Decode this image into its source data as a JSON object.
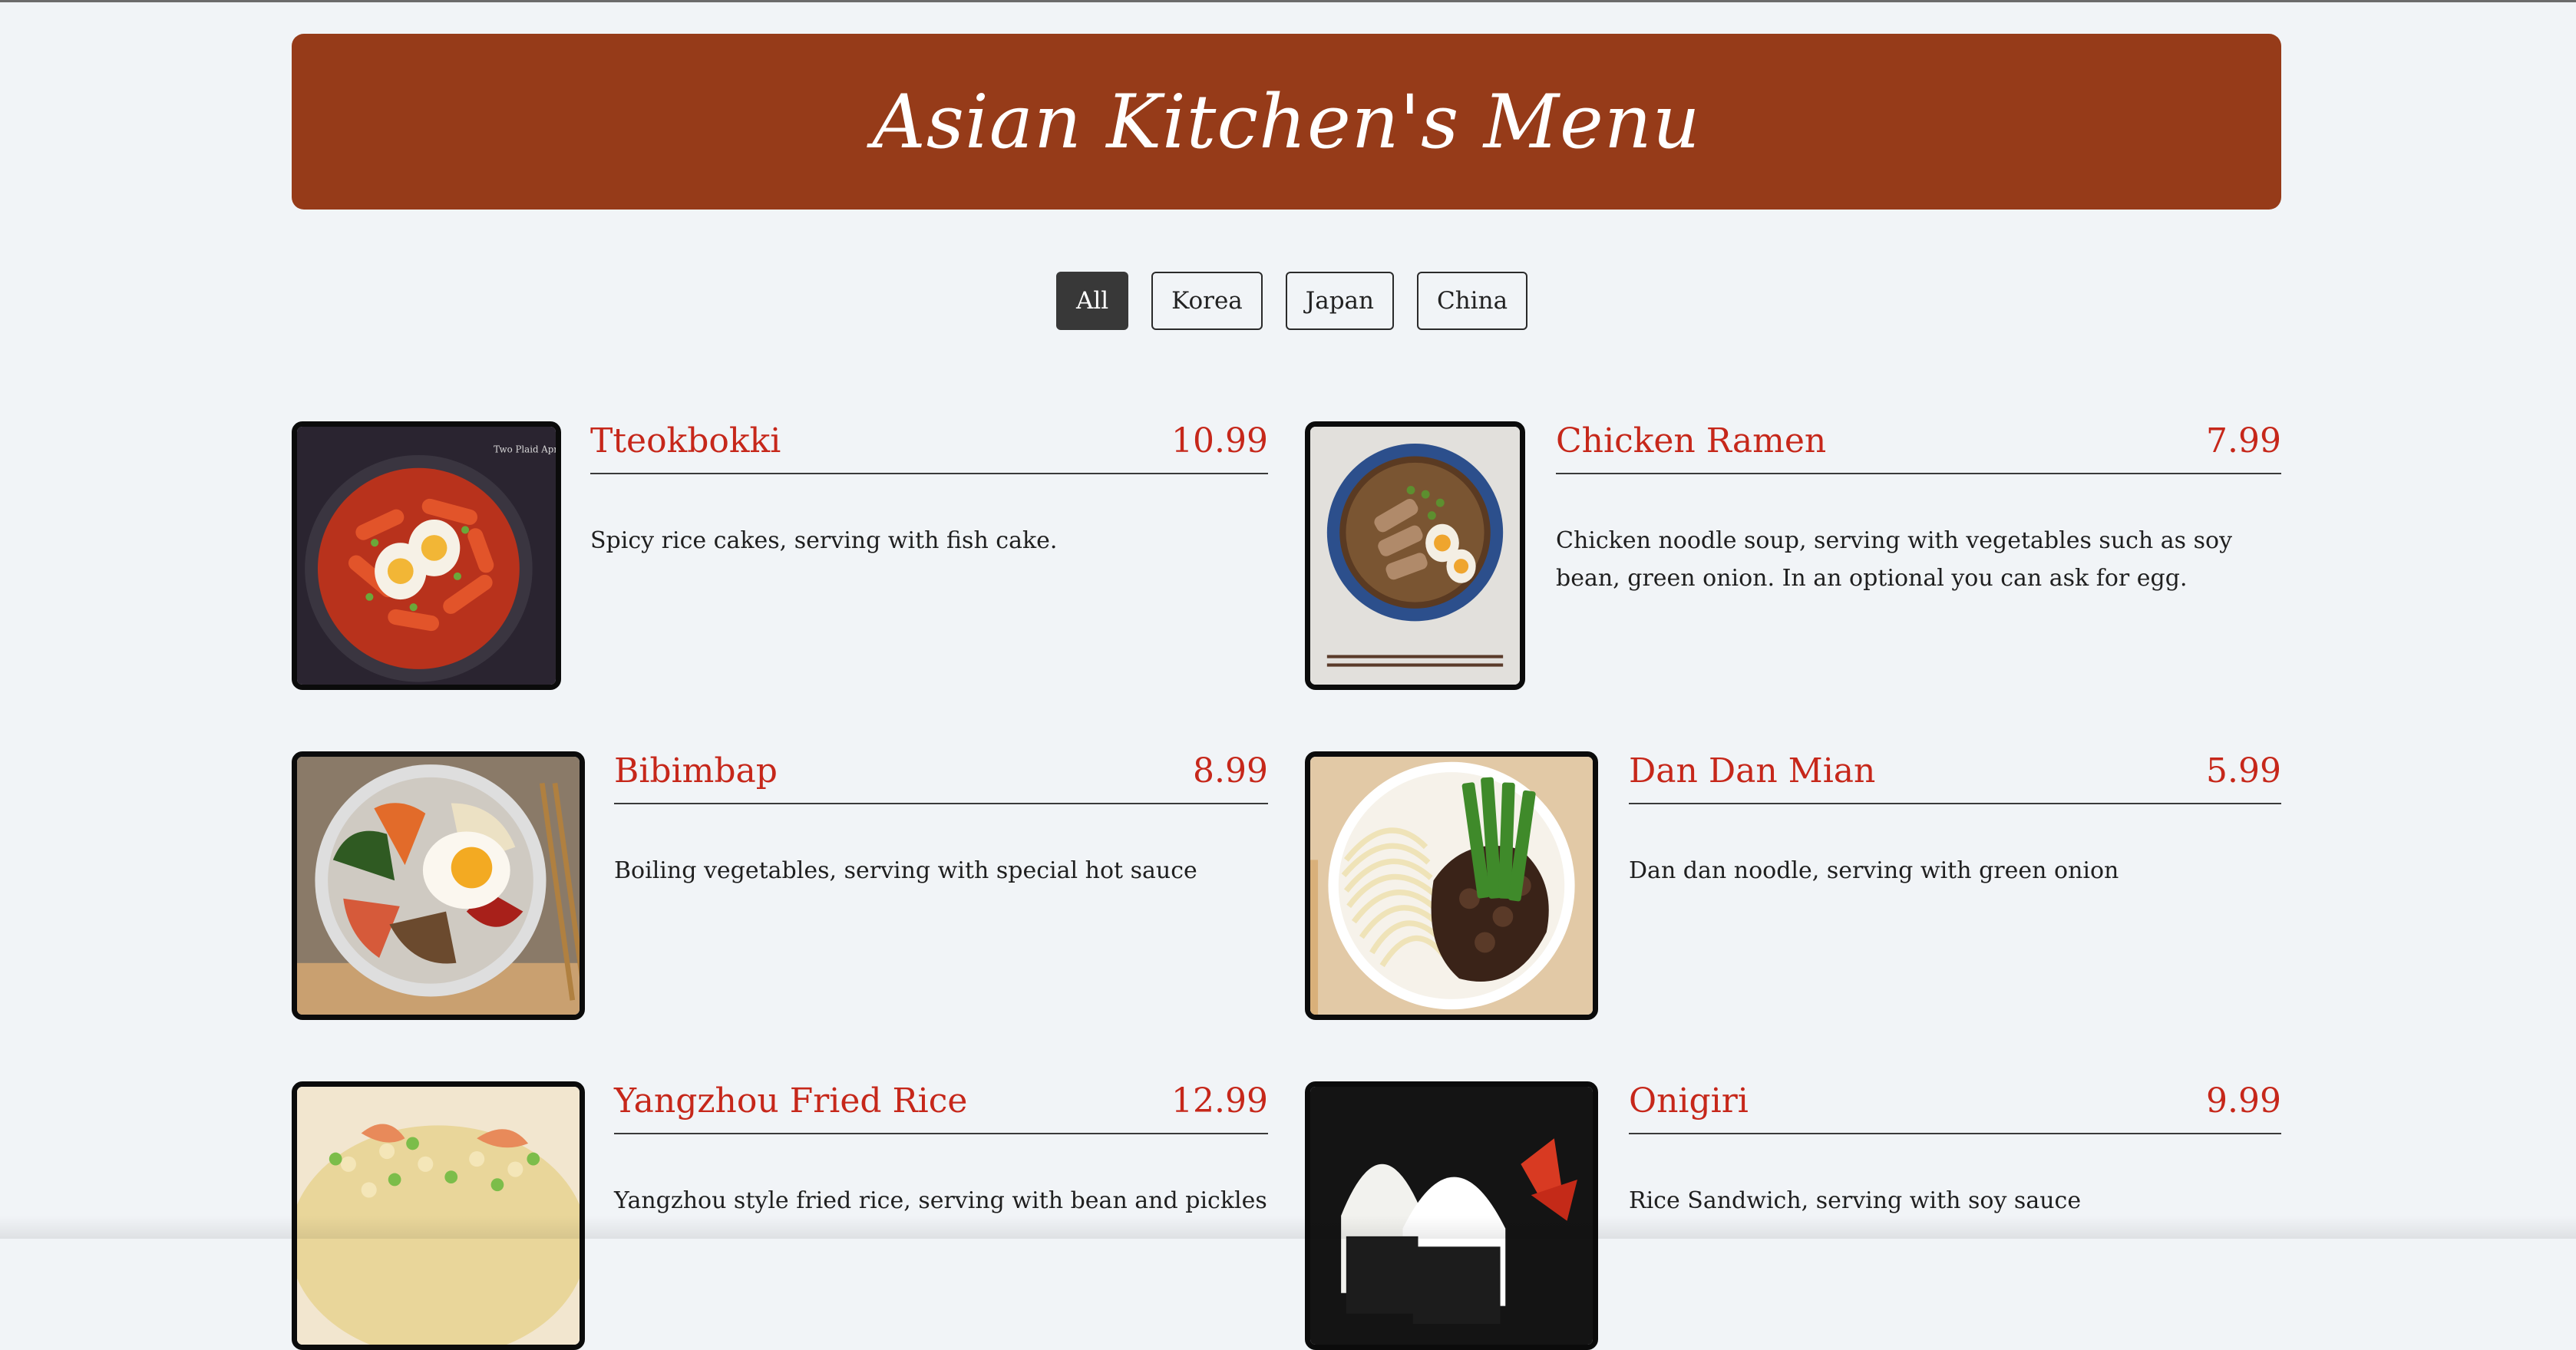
{
  "header": {
    "title": "Asian Kitchen's Menu"
  },
  "filters": [
    "All",
    "Korea",
    "Japan",
    "China"
  ],
  "active_filter": "All",
  "menu": [
    {
      "name": "Tteokbokki",
      "price": "10.99",
      "description": "Spicy rice cakes, serving with fish cake.",
      "image": "tteokbokki-photo",
      "image_caption": "Two Plaid Aprons"
    },
    {
      "name": "Chicken Ramen",
      "price": "7.99",
      "description": "Chicken noodle soup, serving with vegetables such as soy bean, green onion. In an optional you can ask for egg.",
      "image": "chicken-ramen-photo"
    },
    {
      "name": "Bibimbap",
      "price": "8.99",
      "description": "Boiling vegetables, serving with special hot sauce",
      "image": "bibimbap-photo"
    },
    {
      "name": "Dan Dan Mian",
      "price": "5.99",
      "description": "Dan dan noodle, serving with green onion",
      "image": "dan-dan-mian-photo"
    },
    {
      "name": "Yangzhou Fried Rice",
      "price": "12.99",
      "description": "Yangzhou style fried rice, serving with bean and pickles",
      "image": "yangzhou-fried-rice-photo"
    },
    {
      "name": "Onigiri",
      "price": "9.99",
      "description": "Rice Sandwich, serving with soy sauce",
      "image": "onigiri-photo"
    }
  ],
  "colors": {
    "header_bg": "#963b19",
    "accent_red": "#c6271a",
    "page_bg": "#f1f4f7",
    "active_filter_bg": "#383838"
  }
}
